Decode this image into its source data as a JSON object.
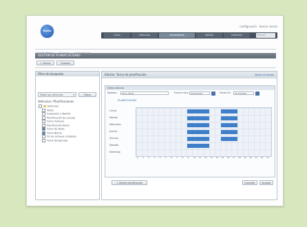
{
  "header": {
    "logo_text": "Rantu",
    "top_links": "configuració · tancar sessió"
  },
  "nav": {
    "tabs": [
      "inicio",
      "vehículos",
      "conductores",
      "alertas",
      "informes"
    ],
    "active_index": 2,
    "search_placeholder": "Buscar"
  },
  "subnav": {
    "items": [
      "Conductores",
      "Grupos",
      "Calendarios"
    ],
    "active_index": 0
  },
  "section": {
    "title": "GESTIÓN DE PLANIFICACIONES",
    "new_button": "+ Nueva",
    "save_button": "Guardar"
  },
  "left_panel": {
    "title": "Filtro de búsqueda",
    "select_value": "Todos los vehículos",
    "filter_button": "Filtrar",
    "subtitle": "Vehículos / Planificaciones",
    "tree": [
      {
        "label": "Vehículos",
        "checked": false,
        "folder": true,
        "level": 0
      },
      {
        "label": "Todos",
        "checked": false,
        "folder": false,
        "level": 1
      },
      {
        "label": "Furgoneta 1 Madrid",
        "checked": false,
        "folder": false,
        "level": 1
      },
      {
        "label": "Planificación de prueba",
        "checked": false,
        "folder": false,
        "level": 1
      },
      {
        "label": "Turno mañana",
        "checked": false,
        "folder": false,
        "level": 1
      },
      {
        "label": "Planificación Norte",
        "checked": false,
        "folder": false,
        "level": 1
      },
      {
        "label": "Turno de Tarde",
        "checked": true,
        "folder": false,
        "level": 1
      },
      {
        "label": "Turno Noche",
        "checked": true,
        "folder": false,
        "level": 1
      },
      {
        "label": "Fin de semana completo",
        "checked": false,
        "folder": false,
        "level": 1
      },
      {
        "label": "Turno Temporada",
        "checked": false,
        "folder": false,
        "level": 1
      }
    ]
  },
  "right_panel": {
    "title": "Edición: Turno de planificación",
    "link": "Volver al listado",
    "inner_title": "Datos básicos",
    "name_label": "Nombre",
    "name_value": "Turno Tarde",
    "start_label": "Fecha inicio",
    "start_value": "01/01/2013",
    "end_label": "Fecha fin",
    "end_value": "31/12/2013",
    "schedule_title": "PLANIFICACIÓN",
    "days": [
      "Lunes",
      "Martes",
      "Miércoles",
      "Jueves",
      "Viernes",
      "Sábado",
      "Domingo"
    ],
    "hours": [
      "0",
      "1",
      "2",
      "3",
      "4",
      "5",
      "6",
      "7",
      "8",
      "9",
      "10",
      "11",
      "12",
      "13",
      "14",
      "15",
      "16",
      "17",
      "18",
      "19",
      "20",
      "21",
      "22",
      "23"
    ],
    "schedule": [
      {
        "day": 0,
        "blocks": [
          [
            9,
            13
          ],
          [
            15,
            18
          ]
        ]
      },
      {
        "day": 1,
        "blocks": [
          [
            9,
            13
          ],
          [
            15,
            18
          ]
        ]
      },
      {
        "day": 2,
        "blocks": [
          [
            9,
            13
          ],
          [
            15,
            18
          ]
        ]
      },
      {
        "day": 3,
        "blocks": [
          [
            9,
            13
          ],
          [
            15,
            18
          ]
        ]
      },
      {
        "day": 4,
        "blocks": [
          [
            9,
            13
          ],
          [
            15,
            18
          ]
        ]
      },
      {
        "day": 5,
        "blocks": [
          [
            9,
            13
          ]
        ]
      },
      {
        "day": 6,
        "blocks": []
      }
    ],
    "bottom_button": "+ Añadir planificación",
    "cancel_button": "Cancelar",
    "accept_button": "Aceptar"
  }
}
